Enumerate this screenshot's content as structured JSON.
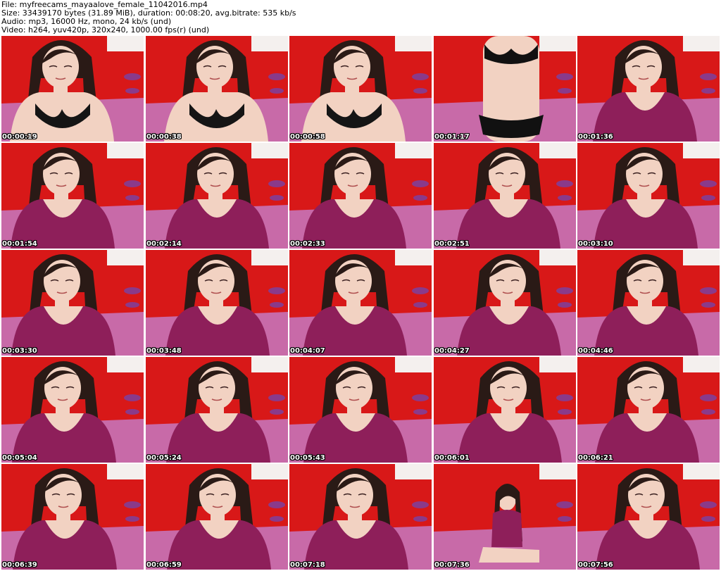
{
  "header": {
    "file_line": "File: myfreecams_mayaalove_female_11042016.mp4",
    "size_line": "Size: 33439170 bytes (31.89 MiB), duration: 00:08:20, avg.bitrate: 535 kb/s",
    "audio_line": "Audio: mp3, 16000 Hz, mono, 24 kb/s (und)",
    "video_line": "Video: h264, yuv420p, 320x240, 1000.00 fps(r) (und)"
  },
  "thumbnails": [
    {
      "timestamp": "00:00:19",
      "top": "bra"
    },
    {
      "timestamp": "00:00:38",
      "top": "bra"
    },
    {
      "timestamp": "00:00:58",
      "top": "bra"
    },
    {
      "timestamp": "00:01:17",
      "top": "underwear"
    },
    {
      "timestamp": "00:01:36",
      "top": "shirt"
    },
    {
      "timestamp": "00:01:54",
      "top": "shirt"
    },
    {
      "timestamp": "00:02:14",
      "top": "shirt"
    },
    {
      "timestamp": "00:02:33",
      "top": "shirt"
    },
    {
      "timestamp": "00:02:51",
      "top": "shirt"
    },
    {
      "timestamp": "00:03:10",
      "top": "shirt"
    },
    {
      "timestamp": "00:03:30",
      "top": "shirt"
    },
    {
      "timestamp": "00:03:48",
      "top": "shirt"
    },
    {
      "timestamp": "00:04:07",
      "top": "shirt"
    },
    {
      "timestamp": "00:04:27",
      "top": "shirt"
    },
    {
      "timestamp": "00:04:46",
      "top": "shirt"
    },
    {
      "timestamp": "00:05:04",
      "top": "shirt"
    },
    {
      "timestamp": "00:05:24",
      "top": "shirt"
    },
    {
      "timestamp": "00:05:43",
      "top": "shirt"
    },
    {
      "timestamp": "00:06:01",
      "top": "shirt"
    },
    {
      "timestamp": "00:06:21",
      "top": "shirt"
    },
    {
      "timestamp": "00:06:39",
      "top": "shirt"
    },
    {
      "timestamp": "00:06:59",
      "top": "shirt"
    },
    {
      "timestamp": "00:07:18",
      "top": "shirt"
    },
    {
      "timestamp": "00:07:36",
      "top": "shirt-far"
    },
    {
      "timestamp": "00:07:56",
      "top": "shirt"
    }
  ],
  "colors": {
    "wall": "#d81818",
    "floor": "#c86aa8",
    "shirt": "#8e1f5a",
    "skin": "#f2d2c2",
    "hair": "#2a1a16",
    "lamp": "#8a3a8a",
    "text": "#000000",
    "timestamp_text": "#ffffff"
  }
}
